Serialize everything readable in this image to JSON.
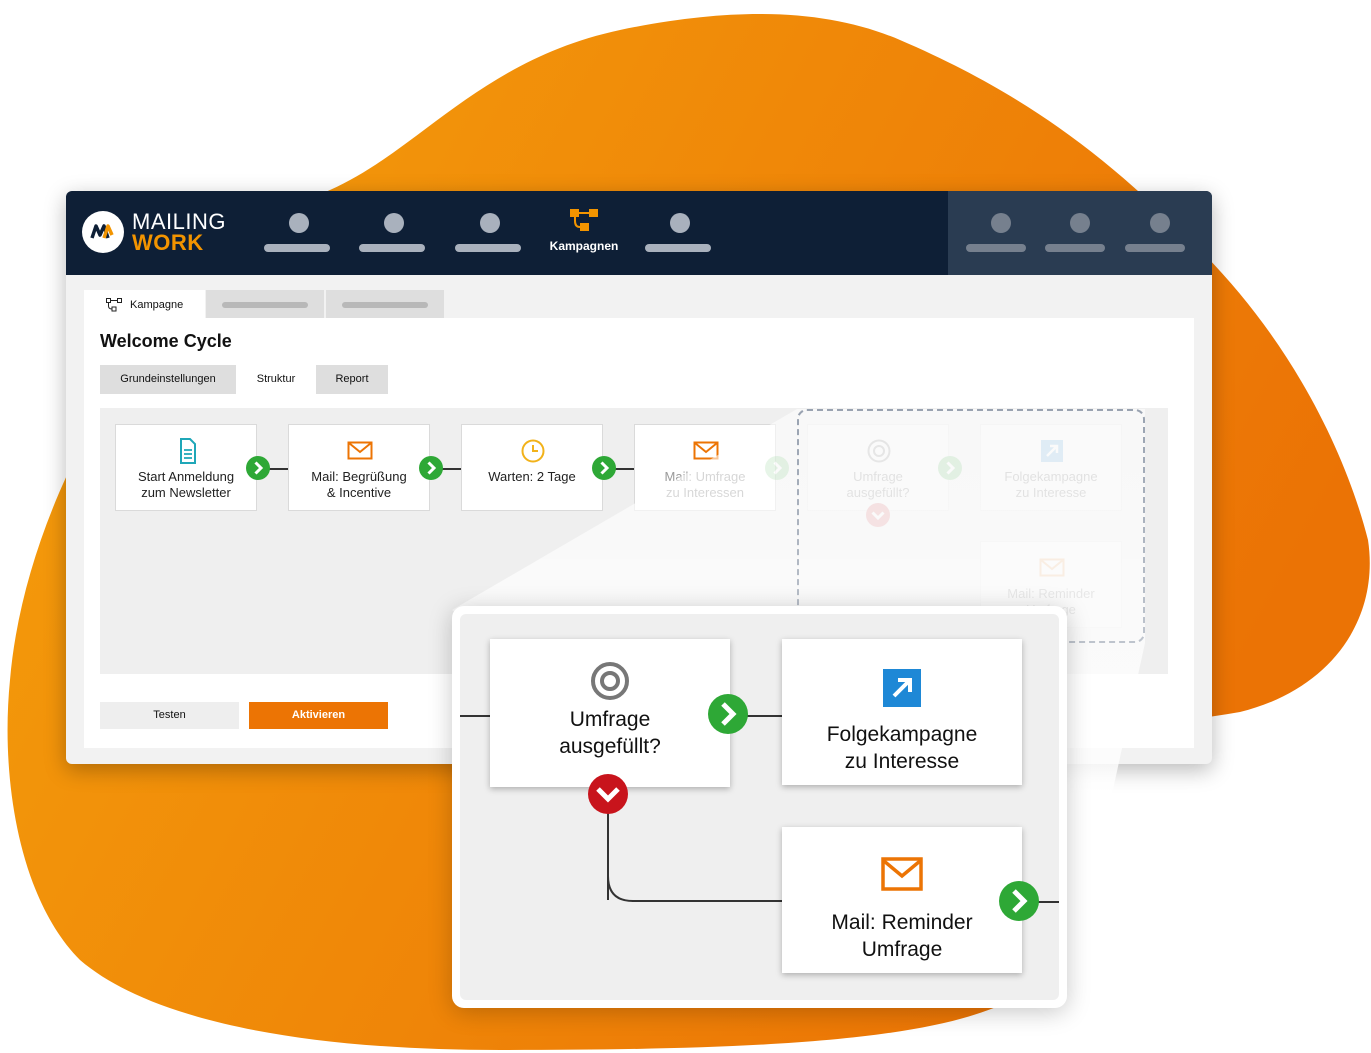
{
  "brand": {
    "line1": "MAILING",
    "line2": "WORK",
    "color_primary": "#ec7404",
    "color_dark": "#0e1f36"
  },
  "topnav": {
    "active_label": "Kampagnen",
    "active_icon": "campaign-flow-icon"
  },
  "tabs_top": {
    "active_label": "Kampagne",
    "active_icon": "campaign-flow-icon"
  },
  "page": {
    "title": "Welcome Cycle"
  },
  "subtabs": [
    "Grundeinstellungen",
    "Struktur",
    "Report"
  ],
  "flow": {
    "nodes": [
      {
        "icon": "document-icon",
        "line1": "Start Anmeldung",
        "line2": "zum Newsletter"
      },
      {
        "icon": "mail-icon",
        "line1": "Mail: Begrüßung",
        "line2": "& Incentive"
      },
      {
        "icon": "clock-icon",
        "line1": "Warten: 2 Tage",
        "line2": ""
      },
      {
        "icon": "mail-icon",
        "line1": "Mail: Umfrage",
        "line2": "zu Interessen"
      },
      {
        "icon": "target-icon",
        "line1": "Umfrage",
        "line2": "ausgefüllt?"
      },
      {
        "icon": "external-link-icon",
        "line1": "Folgekampagne",
        "line2": "zu Interesse"
      },
      {
        "icon": "mail-icon",
        "line1": "Mail: Reminder",
        "line2": "Umfrage"
      }
    ]
  },
  "buttons": {
    "test": "Testen",
    "activate": "Aktivieren"
  },
  "zoom": {
    "decision": {
      "line1": "Umfrage",
      "line2": "ausgefüllt?"
    },
    "follow": {
      "line1": "Folgekampagne",
      "line2": "zu Interesse"
    },
    "reminder": {
      "line1": "Mail: Reminder",
      "line2": "Umfrage"
    }
  }
}
